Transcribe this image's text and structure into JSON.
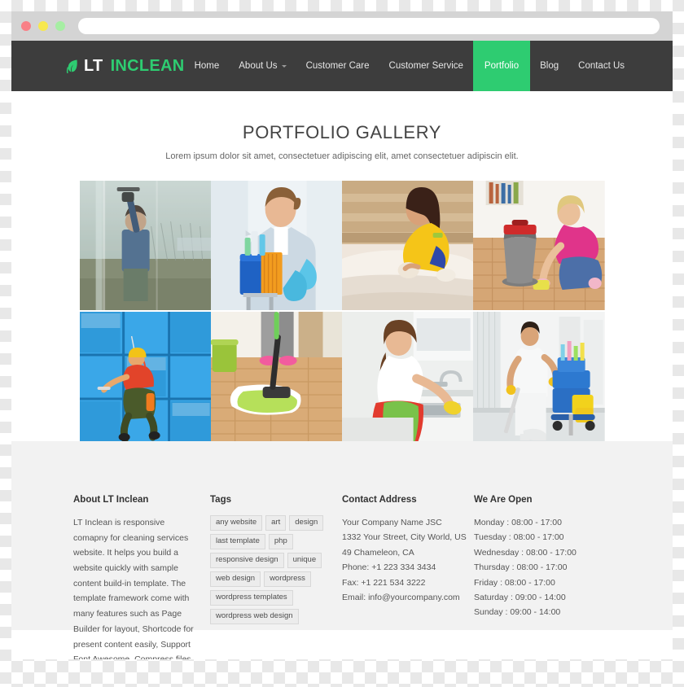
{
  "browser": {
    "url_value": "",
    "url_placeholder": "",
    "traffic_lights": [
      "close-red",
      "minimize-yellow",
      "maximize-green"
    ]
  },
  "header": {
    "logo": {
      "icon": "leaf-icon",
      "text_primary": "LT",
      "text_secondary": "INCLEAN",
      "color_primary": "#ffffff",
      "color_secondary": "#2ecc71"
    },
    "nav": [
      {
        "label": "Home",
        "active": false,
        "has_caret": false
      },
      {
        "label": "About Us",
        "active": false,
        "has_caret": true
      },
      {
        "label": "Customer Care",
        "active": false,
        "has_caret": false
      },
      {
        "label": "Customer Service",
        "active": false,
        "has_caret": false
      },
      {
        "label": "Portfolio",
        "active": true,
        "has_caret": false
      },
      {
        "label": "Blog",
        "active": false,
        "has_caret": false
      },
      {
        "label": "Contact Us",
        "active": false,
        "has_caret": false
      }
    ],
    "bg_color": "#3d3d3d",
    "accent_color": "#2ecc71"
  },
  "main": {
    "title": "PORTFOLIO GALLERY",
    "subtitle": "Lorem ipsum dolor sit amet, consectetuer adipiscing elit, amet consectetuer adipiscin elit.",
    "gallery": [
      {
        "name": "window-cleaner-exterior",
        "alt": "Man squeegee cleaning a large window outdoors"
      },
      {
        "name": "maid-with-cleaning-bucket",
        "alt": "Smiling maid holding blue bucket with cleaning supplies"
      },
      {
        "name": "bathtub-cleaning",
        "alt": "Woman in yellow shirt scrubbing a bathtub"
      },
      {
        "name": "floor-scrubbing-kneeling",
        "alt": "Blonde woman kneeling wiping a wooden floor"
      },
      {
        "name": "high-rise-window-abseil",
        "alt": "Rope-access worker cleaning a blue glass facade"
      },
      {
        "name": "mopping-wood-floor",
        "alt": "Person mopping a wooden floor with a green flat mop"
      },
      {
        "name": "kitchen-counter-cleaning",
        "alt": "Woman in apron wiping a kitchen counter and sink"
      },
      {
        "name": "janitor-with-cart",
        "alt": "Janitor mopping a corridor beside a cleaning cart"
      }
    ]
  },
  "footer": {
    "about": {
      "title": "About LT Inclean",
      "body": "LT Inclean is responsive comapny for cleaning services website. It helps you build a website quickly with sample content build-in template. The template framework come with many features such as Page Builder for layout, Shortcode for present content easily, Support Font Awesome, Compress files and so on."
    },
    "tags": {
      "title": "Tags",
      "items": [
        "any website",
        "art",
        "design",
        "last template",
        "php",
        "responsive design",
        "unique",
        "web design",
        "wordpress",
        "wordpress templates",
        "wordpress web design"
      ]
    },
    "contact": {
      "title": "Contact Address",
      "lines": [
        "Your Company Name JSC",
        "1332 Your Street, City World, US",
        "49 Chameleon, CA",
        "Phone: +1 223 334 3434",
        "Fax: +1 221 534 3222",
        "Email: info@yourcompany.com"
      ]
    },
    "hours": {
      "title": "We Are Open",
      "lines": [
        "Monday : 08:00 - 17:00",
        "Tuesday : 08:00 - 17:00",
        "Wednesday : 08:00 - 17:00",
        "Thursday : 08:00 - 17:00",
        "Friday : 08:00 - 17:00",
        "Saturday : 09:00 - 14:00",
        "Sunday : 09:00 - 14:00"
      ]
    }
  }
}
